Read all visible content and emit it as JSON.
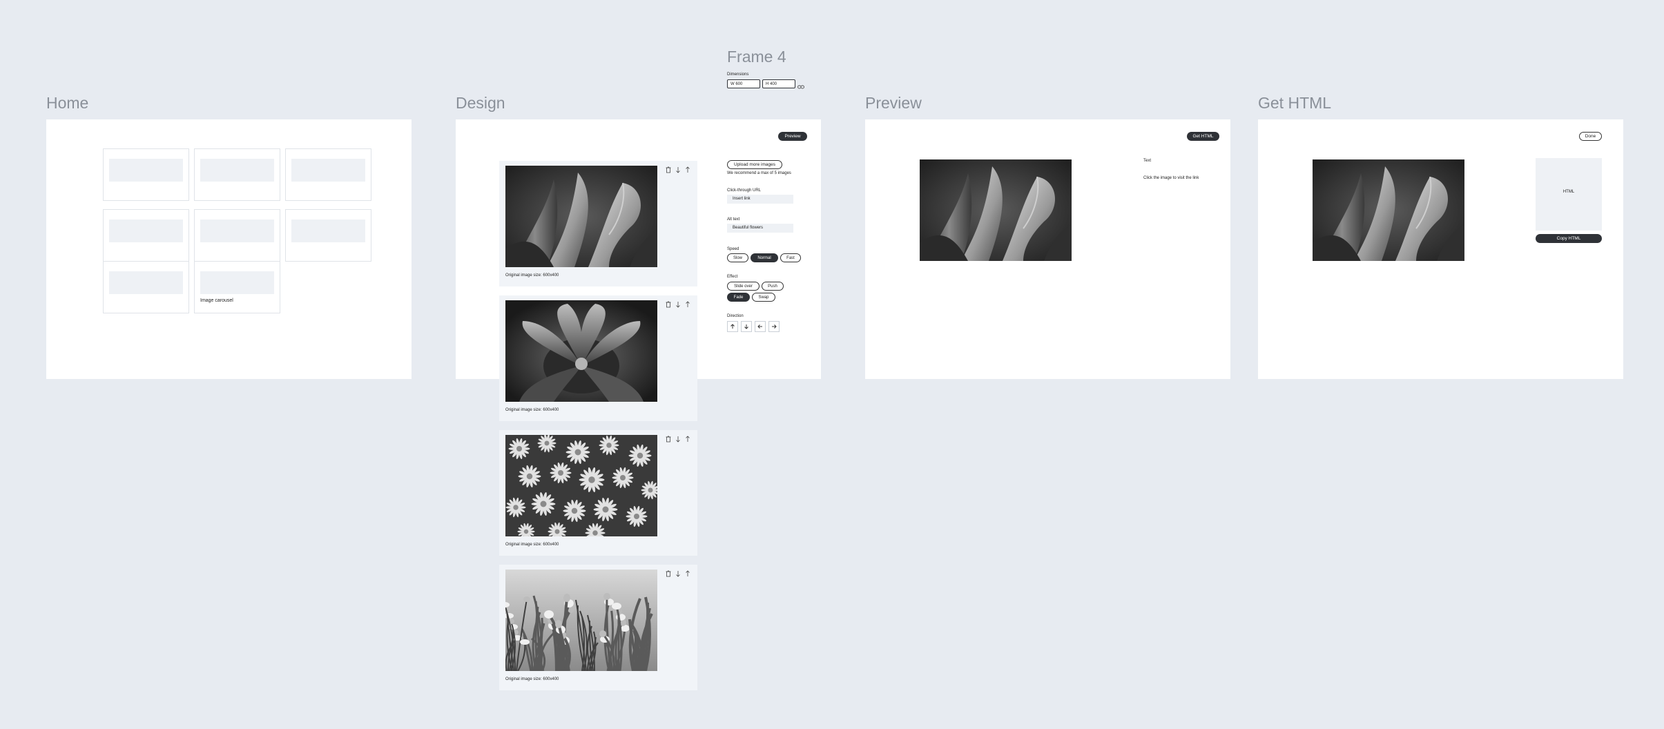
{
  "frames": {
    "home_title": "Home",
    "design_title": "Design",
    "preview_title": "Preview",
    "gethtml_title": "Get HTML"
  },
  "frame4": {
    "title": "Frame 4",
    "dimensions_label": "Dimensions",
    "width_value": "W 600",
    "height_value": "H 400"
  },
  "home": {
    "tile_label": "Image carousel"
  },
  "design": {
    "preview_button": "Preview",
    "upload_button": "Upload more images",
    "recommend_text": "We recommend a max of 5 images",
    "click_url_label": "Click-through URL",
    "click_url_placeholder": "Insert link",
    "alt_text_label": "Alt text",
    "alt_text_value": "Beautiful flowers",
    "speed_label": "Speed",
    "speed_options": [
      "Slow",
      "Normal",
      "Fast"
    ],
    "speed_selected": "Normal",
    "effect_label": "Effect",
    "effect_options": [
      "Slide over",
      "Push",
      "Fade",
      "Swap"
    ],
    "effect_selected": "Fade",
    "direction_label": "Direction",
    "image_caption": "Original image size: 600x400"
  },
  "preview": {
    "get_html_button": "Get HTML",
    "text_label": "Text",
    "text_value": "Click the image to visit the link"
  },
  "gethtml": {
    "done_button": "Done",
    "html_label": "HTML",
    "copy_button": "Copy HTML"
  },
  "colors": {
    "canvas": "#e7ebf1",
    "frame": "#ffffff",
    "dark_button": "#2f3237",
    "light_panel": "#f1f4f8"
  }
}
